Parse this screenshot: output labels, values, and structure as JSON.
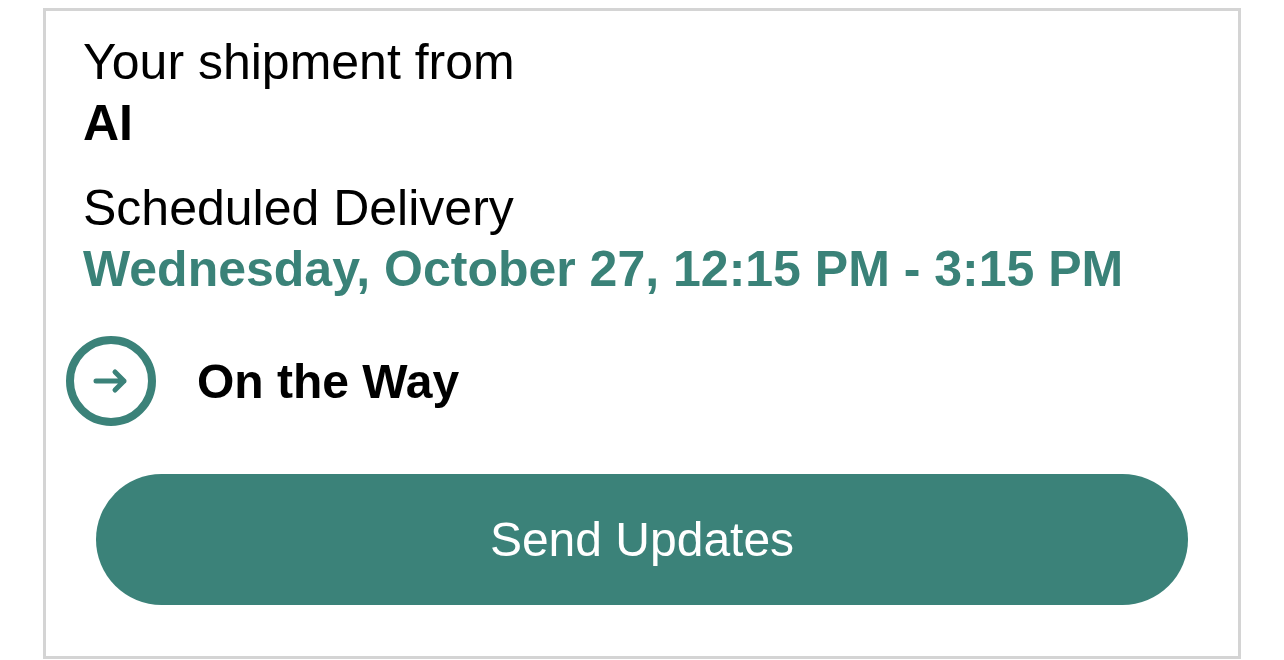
{
  "shipment": {
    "intro": "Your shipment from",
    "sender": "AI"
  },
  "delivery": {
    "label": "Scheduled Delivery",
    "window": "Wednesday, October 27, 12:15 PM - 3:15 PM"
  },
  "status": {
    "kind": "on_the_way",
    "label": "On the Way"
  },
  "buttons": [
    {
      "label": "Send Updates"
    }
  ]
}
